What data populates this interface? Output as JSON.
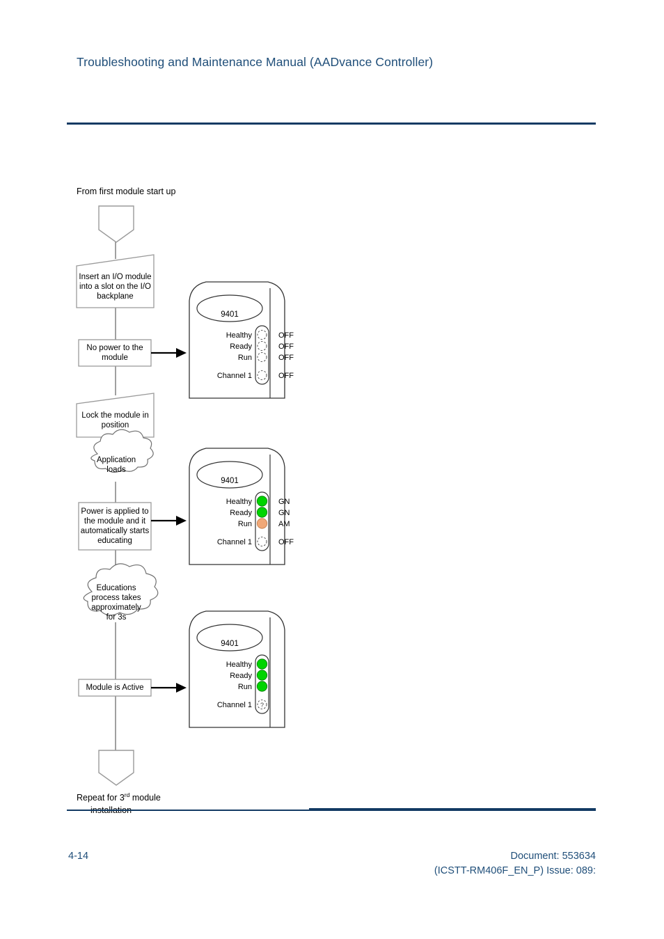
{
  "header": {
    "title": "Troubleshooting and Maintenance Manual (AADvance Controller)",
    "rule_color": "#123a63"
  },
  "footer": {
    "page_number": "4-14",
    "document_line1": "Document: 553634",
    "document_line2": "(ICSTT-RM406F_EN_P) Issue: 089:"
  },
  "flowchart": {
    "start_label": "From first module start up",
    "end_label_line1_prefix": "Repeat for 3",
    "end_label_superscript": "rd",
    "end_label_line1_suffix": " module",
    "end_label_line2": "installation",
    "steps": [
      {
        "id": "insert-module",
        "text": "Insert an I/O module\ninto a slot on the I/O\nbackplane",
        "shape": "trapezoid"
      },
      {
        "id": "no-power",
        "text": "No power to the\nmodule",
        "shape": "rect"
      },
      {
        "id": "lock-module",
        "text": "Lock the module in\nposition",
        "shape": "trapezoid"
      },
      {
        "id": "application-loads",
        "text": "Application\nloads",
        "shape": "cloud"
      },
      {
        "id": "power-applied",
        "text": "Power is applied to\nthe module and it\nautomatically starts\neducating",
        "shape": "rect"
      },
      {
        "id": "education-process",
        "text": "Educations\nprocess takes\napproximately\nfor 3s",
        "shape": "cloud"
      },
      {
        "id": "module-active",
        "text": "Module is Active",
        "shape": "rect"
      }
    ]
  },
  "modules": [
    {
      "id": "module-panel-1",
      "model": "9401",
      "leds": [
        {
          "label": "Healthy",
          "state": "OFF",
          "state_label": "OFF",
          "color": "none"
        },
        {
          "label": "Ready",
          "state": "OFF",
          "state_label": "OFF",
          "color": "none"
        },
        {
          "label": "Run",
          "state": "OFF",
          "state_label": "OFF",
          "color": "none"
        },
        {
          "label": "Channel 1",
          "state": "OFF",
          "state_label": "OFF",
          "color": "none"
        }
      ]
    },
    {
      "id": "module-panel-2",
      "model": "9401",
      "leds": [
        {
          "label": "Healthy",
          "state": "GN",
          "state_label": "GN",
          "color": "#00d400"
        },
        {
          "label": "Ready",
          "state": "GN",
          "state_label": "GN",
          "color": "#00d400"
        },
        {
          "label": "Run",
          "state": "AM",
          "state_label": "AM",
          "color": "#f0a878"
        },
        {
          "label": "Channel 1",
          "state": "OFF",
          "state_label": "OFF",
          "color": "none"
        }
      ]
    },
    {
      "id": "module-panel-3",
      "model": "9401",
      "leds": [
        {
          "label": "Healthy",
          "state": "GN",
          "state_label": "",
          "color": "#00d400"
        },
        {
          "label": "Ready",
          "state": "GN",
          "state_label": "",
          "color": "#00d400"
        },
        {
          "label": "Run",
          "state": "GN",
          "state_label": "",
          "color": "#00d400"
        },
        {
          "label": "Channel 1",
          "state": "UNKNOWN",
          "state_label": "",
          "color": "none",
          "glyph": "?"
        }
      ]
    }
  ],
  "colors": {
    "brand_navy": "#123a63",
    "title_blue": "#1f4e79",
    "led_green": "#00d400",
    "led_amber": "#f0a878",
    "line_black": "#000000",
    "box_outline": "#808080"
  }
}
